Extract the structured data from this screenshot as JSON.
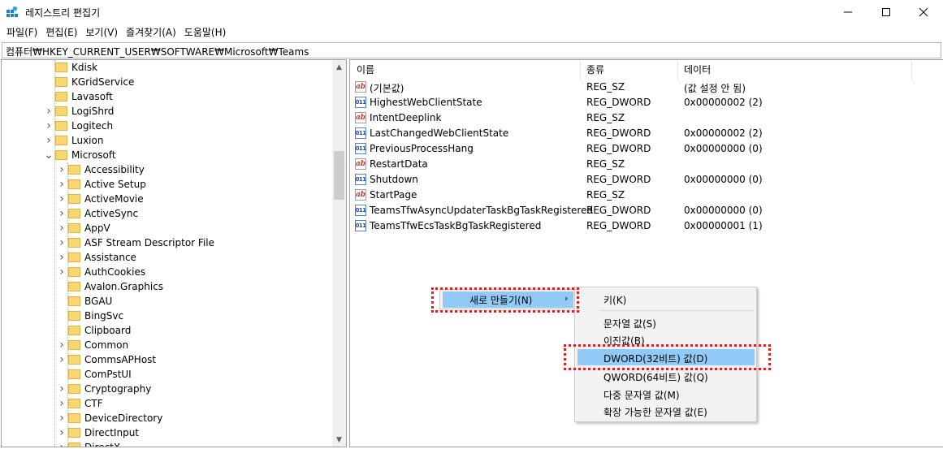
{
  "window": {
    "title": "레지스트리 편집기",
    "minimize_glyph": "—",
    "maximize_glyph": "☐",
    "close_glyph": "✕"
  },
  "menubar": [
    "파일(F)",
    "편집(E)",
    "보기(V)",
    "즐겨찾기(A)",
    "도움말(H)"
  ],
  "address": "컴퓨터₩HKEY_CURRENT_USER₩SOFTWARE₩Microsoft₩Teams",
  "tree": {
    "top_items": [
      {
        "label": "Kdisk",
        "expandable": false
      },
      {
        "label": "KGridService",
        "expandable": false
      },
      {
        "label": "Lavasoft",
        "expandable": false
      },
      {
        "label": "LogiShrd",
        "expandable": true
      },
      {
        "label": "Logitech",
        "expandable": true
      },
      {
        "label": "Luxion",
        "expandable": true
      },
      {
        "label": "Microsoft",
        "expandable": true,
        "expanded": true
      }
    ],
    "children": [
      {
        "label": "Accessibility",
        "expandable": true
      },
      {
        "label": "Active Setup",
        "expandable": true
      },
      {
        "label": "ActiveMovie",
        "expandable": true
      },
      {
        "label": "ActiveSync",
        "expandable": true
      },
      {
        "label": "AppV",
        "expandable": true
      },
      {
        "label": "ASF Stream Descriptor File",
        "expandable": true
      },
      {
        "label": "Assistance",
        "expandable": true
      },
      {
        "label": "AuthCookies",
        "expandable": true
      },
      {
        "label": "Avalon.Graphics",
        "expandable": false
      },
      {
        "label": "BGAU",
        "expandable": false
      },
      {
        "label": "BingSvc",
        "expandable": false
      },
      {
        "label": "Clipboard",
        "expandable": false
      },
      {
        "label": "Common",
        "expandable": true
      },
      {
        "label": "CommsAPHost",
        "expandable": true
      },
      {
        "label": "ComPstUI",
        "expandable": false
      },
      {
        "label": "Cryptography",
        "expandable": true
      },
      {
        "label": "CTF",
        "expandable": true
      },
      {
        "label": "DeviceDirectory",
        "expandable": true
      },
      {
        "label": "DirectInput",
        "expandable": true
      },
      {
        "label": "DirectX",
        "expandable": true
      }
    ]
  },
  "columns": {
    "name": "이름",
    "type": "종류",
    "data": "데이터"
  },
  "values": [
    {
      "name": "(기본값)",
      "type": "REG_SZ",
      "data": "(값 설정 안 됨)",
      "icon": "string-value-icon"
    },
    {
      "name": "HighestWebClientState",
      "type": "REG_DWORD",
      "data": "0x00000002 (2)",
      "icon": "dword-value-icon"
    },
    {
      "name": "IntentDeeplink",
      "type": "REG_SZ",
      "data": "",
      "icon": "string-value-icon"
    },
    {
      "name": "LastChangedWebClientState",
      "type": "REG_DWORD",
      "data": "0x00000002 (2)",
      "icon": "dword-value-icon"
    },
    {
      "name": "PreviousProcessHang",
      "type": "REG_DWORD",
      "data": "0x00000000 (0)",
      "icon": "dword-value-icon"
    },
    {
      "name": "RestartData",
      "type": "REG_SZ",
      "data": "",
      "icon": "string-value-icon"
    },
    {
      "name": "Shutdown",
      "type": "REG_DWORD",
      "data": "0x00000000 (0)",
      "icon": "dword-value-icon"
    },
    {
      "name": "StartPage",
      "type": "REG_SZ",
      "data": "",
      "icon": "string-value-icon"
    },
    {
      "name": "TeamsTfwAsyncUpdaterTaskBgTaskRegistered",
      "type": "REG_DWORD",
      "data": "0x00000000 (0)",
      "icon": "dword-value-icon"
    },
    {
      "name": "TeamsTfwEcsTaskBgTaskRegistered",
      "type": "REG_DWORD",
      "data": "0x00000001 (1)",
      "icon": "dword-value-icon"
    }
  ],
  "context_menu": {
    "new_label": "새로 만들기(N)",
    "new_arrow": "›",
    "submenu": [
      {
        "label": "키(K)"
      },
      {
        "label": "문자열 값(S)"
      },
      {
        "label": "이진값(B)"
      },
      {
        "label": "DWORD(32비트) 값(D)",
        "highlighted": true
      },
      {
        "label": "QWORD(64비트) 값(Q)"
      },
      {
        "label": "다중 문자열 값(M)"
      },
      {
        "label": "확장 가능한 문자열 값(E)"
      }
    ]
  },
  "colors": {
    "highlight": "#91c9f7",
    "annotation": "#e02020",
    "folder": "#f7d674"
  }
}
